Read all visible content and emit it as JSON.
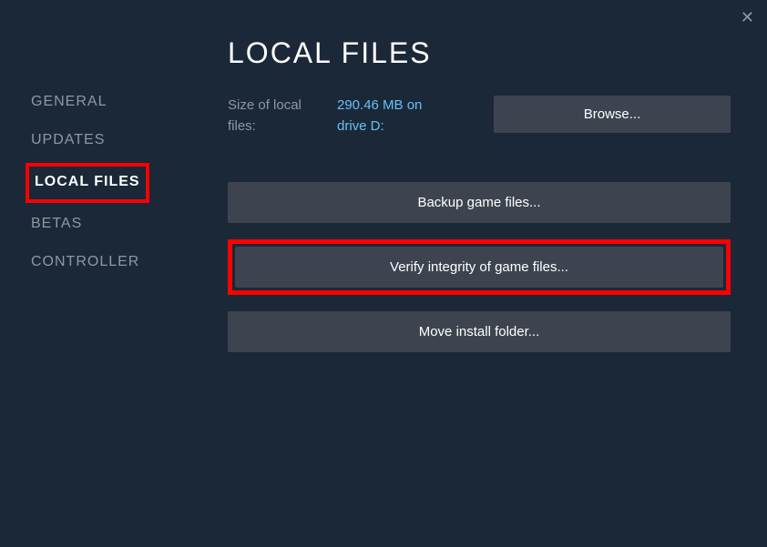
{
  "sidebar": {
    "items": [
      {
        "label": "GENERAL"
      },
      {
        "label": "UPDATES"
      },
      {
        "label": "LOCAL FILES"
      },
      {
        "label": "BETAS"
      },
      {
        "label": "CONTROLLER"
      }
    ]
  },
  "page": {
    "title": "LOCAL FILES"
  },
  "info": {
    "size_label": "Size of local files:",
    "size_value": "290.46 MB on drive D:"
  },
  "buttons": {
    "browse": "Browse...",
    "backup": "Backup game files...",
    "verify": "Verify integrity of game files...",
    "move": "Move install folder..."
  },
  "colors": {
    "accent_link": "#66c0f4",
    "highlight": "#ff0000",
    "button_bg": "#3d4450"
  }
}
